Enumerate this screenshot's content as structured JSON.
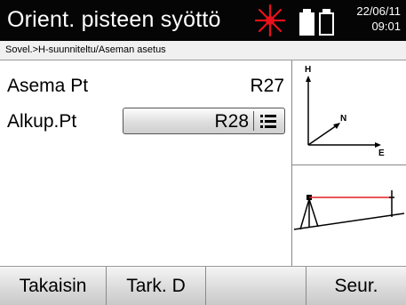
{
  "header": {
    "title": "Orient. pisteen syöttö",
    "date": "22/06/11",
    "time": "09:01",
    "laser_icon": "laser-on-icon",
    "laser_color": "#e8101a",
    "battery_icons": [
      "battery-full-icon",
      "battery-empty-icon"
    ]
  },
  "breadcrumb": "Sovel.>H-suunniteltu/Aseman asetus",
  "form": {
    "station_label": "Asema Pt",
    "station_value": "R27",
    "backsight_label": "Alkup.Pt",
    "backsight_value": "R28",
    "list_icon": "list-icon"
  },
  "diagram": {
    "north_axis_label": "H",
    "n_label": "N",
    "e_label": "E",
    "line_color": "#e02020"
  },
  "softkeys": {
    "back": "Takaisin",
    "check_dist": "Tark. D",
    "empty": "",
    "next": "Seur."
  }
}
